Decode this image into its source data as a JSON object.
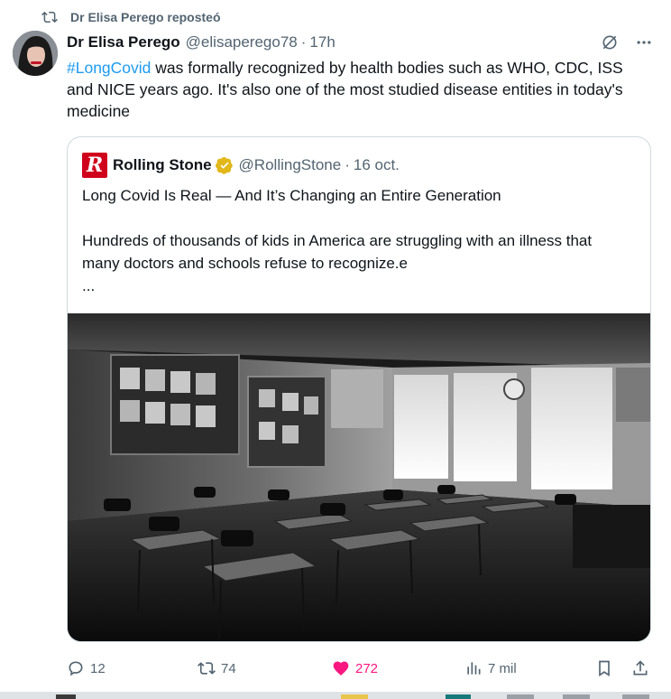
{
  "repost": {
    "text": "Dr Elisa Perego reposteó",
    "icon": "repost-icon"
  },
  "tweet": {
    "author_name": "Dr Elisa Perego",
    "handle": "@elisaperego78",
    "dot": "·",
    "time": "17h",
    "hashtag": "#LongCovid",
    "text_rest": " was formally recognized by health bodies such as WHO, CDC, ISS and NICE years ago. It's also one of the most studied disease entities in today's medicine"
  },
  "quote": {
    "logo_letter": "R",
    "name": "Rolling Stone",
    "handle": "@RollingStone",
    "dot": "·",
    "date": "16 oct.",
    "line1": "Long Covid Is Real — And It’s Changing an Entire Generation",
    "line2": "Hundreds of thousands of kids in America are struggling with an illness that many doctors and schools refuse to recognize.e",
    "ellipsis": "..."
  },
  "actions": {
    "replies": "12",
    "reposts": "74",
    "likes": "272",
    "views": "7 mil"
  },
  "colors": {
    "accent": "#1d9bf0",
    "like": "#f91880",
    "muted": "#536471",
    "border": "#cfd9de",
    "rs_red": "#d0021b",
    "verified_gold": "#e2b719"
  }
}
